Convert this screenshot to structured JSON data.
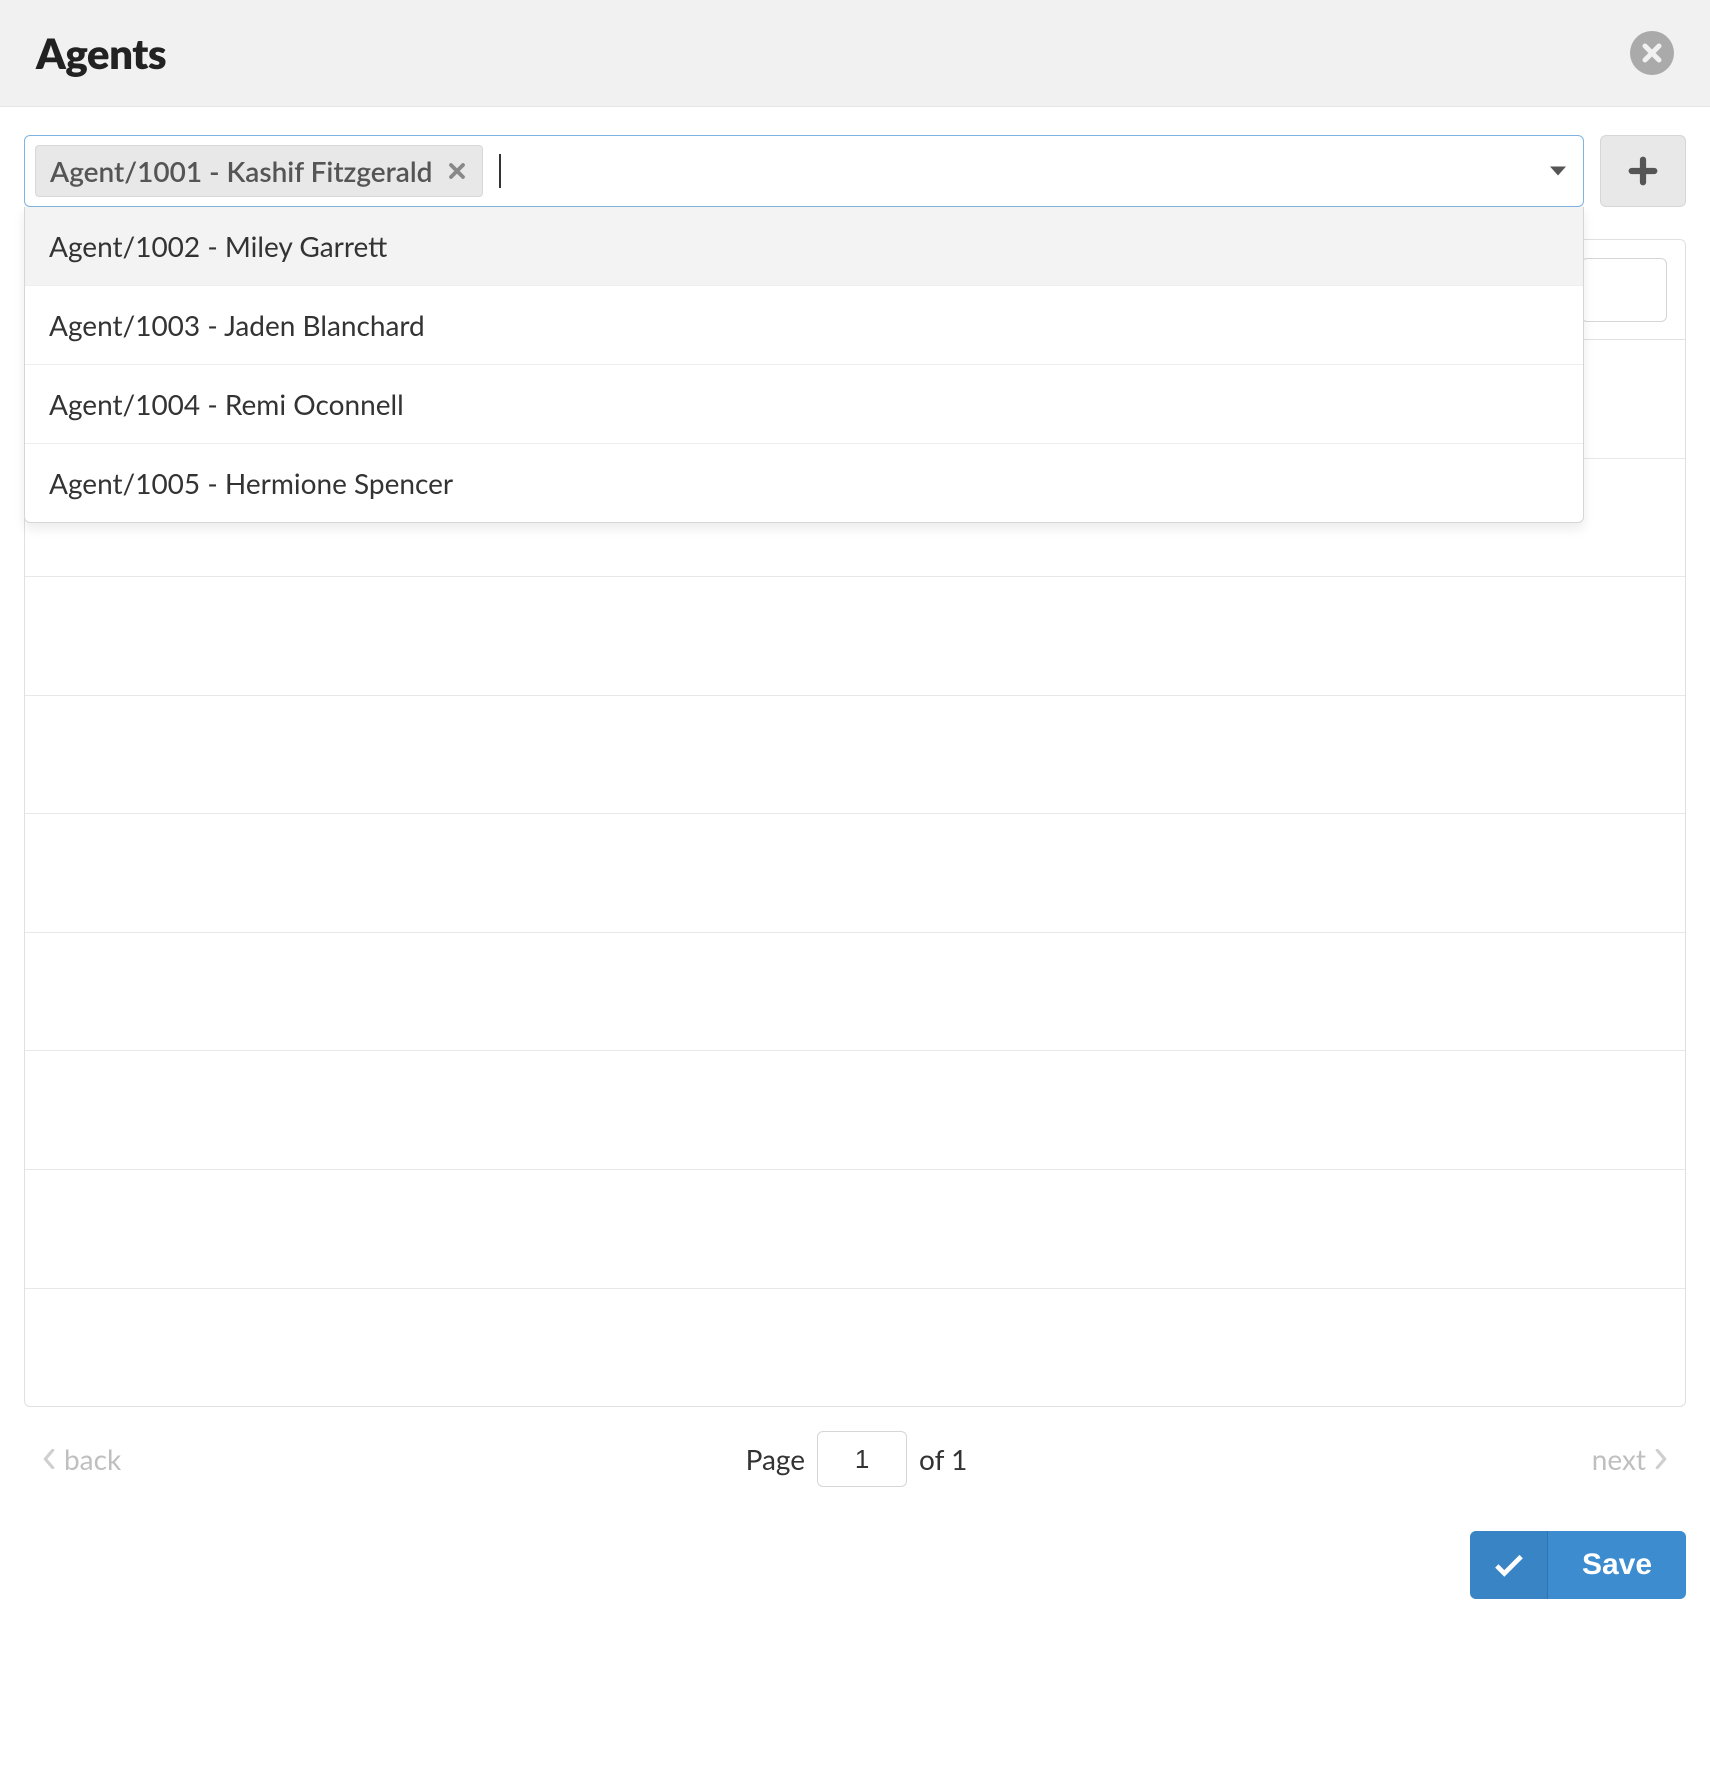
{
  "header": {
    "title": "Agents"
  },
  "selector": {
    "selected_chip": "Agent/1001 - Kashif Fitzgerald",
    "dropdown_options": [
      "Agent/1002 - Miley Garrett",
      "Agent/1003 - Jaden Blanchard",
      "Agent/1004 - Remi Oconnell",
      "Agent/1005 - Hermione Spencer"
    ],
    "highlighted_index": 0
  },
  "pager": {
    "back_label": "back",
    "next_label": "next",
    "page_label": "Page",
    "of_label": "of 1",
    "current_page": "1"
  },
  "footer": {
    "save_label": "Save"
  }
}
